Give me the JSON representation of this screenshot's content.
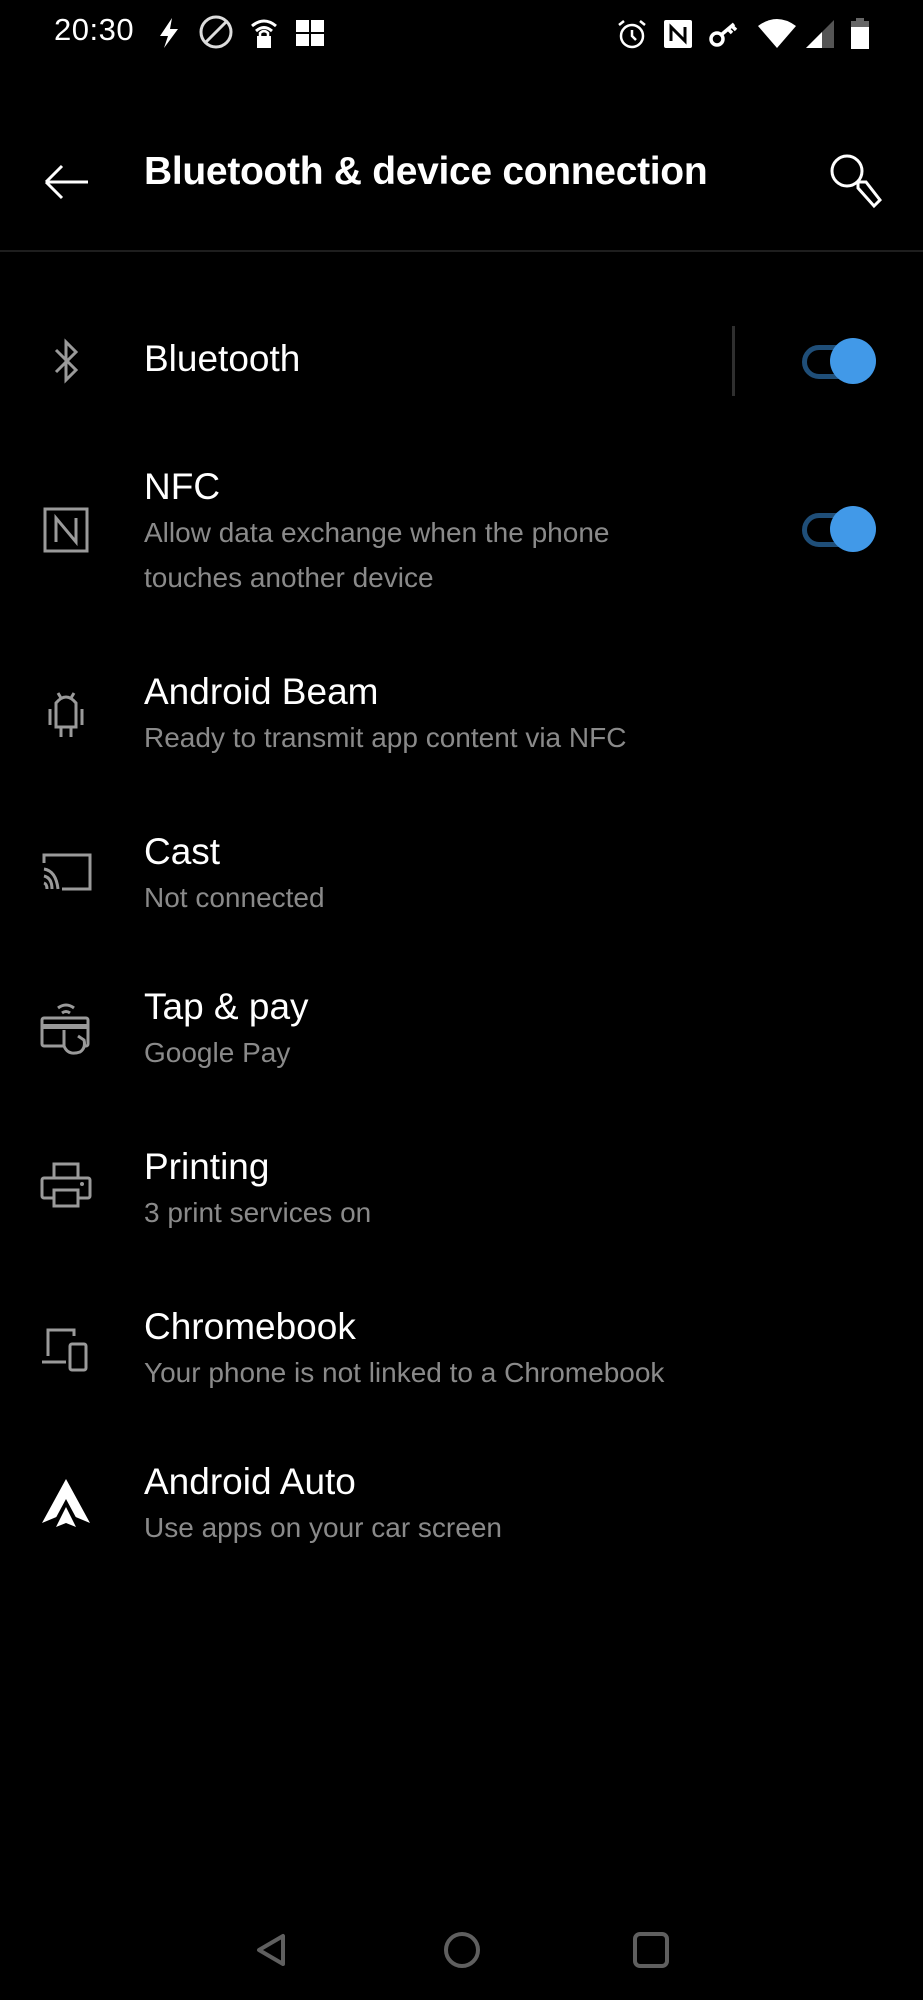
{
  "status_bar": {
    "time": "20:30",
    "left_icons": [
      "flash-icon",
      "no-data-icon",
      "wifi-lock-icon",
      "app-notification-icon"
    ],
    "right_icons": [
      "alarm-icon",
      "nfc-icon",
      "vpn-key-icon",
      "wifi-icon",
      "signal-icon",
      "battery-icon"
    ]
  },
  "app_bar": {
    "title": "Bluetooth & device connection",
    "back_icon": "arrow-back-icon",
    "search_icon": "search-icon"
  },
  "settings": [
    {
      "title": "Bluetooth",
      "subtitle": "",
      "icon": "bluetooth-icon",
      "toggle": true,
      "toggle_on": true
    },
    {
      "title": "NFC",
      "subtitle_lines": [
        "Allow data exchange when the phone",
        "touches another device"
      ],
      "icon": "nfc-icon",
      "toggle": true,
      "toggle_on": true
    },
    {
      "title": "Android Beam",
      "subtitle": "Ready to transmit app content via NFC",
      "icon": "android-icon"
    },
    {
      "title": "Cast",
      "subtitle": "Not connected",
      "icon": "cast-icon"
    },
    {
      "title": "Tap & pay",
      "subtitle": "Google Pay",
      "icon": "tap-pay-icon"
    },
    {
      "title": "Printing",
      "subtitle": "3 print services on",
      "icon": "printer-icon"
    },
    {
      "title": "Chromebook",
      "subtitle": "Your phone is not linked to a Chromebook",
      "icon": "devices-icon"
    },
    {
      "title": "Android Auto",
      "subtitle": "Use apps on your car screen",
      "icon": "android-auto-icon"
    }
  ],
  "nav_bar": {
    "back": "nav-back-icon",
    "home": "nav-home-icon",
    "recents": "nav-recents-icon"
  },
  "colors": {
    "accent": "#4199e8",
    "track": "#1f4e78",
    "subtitle": "#8a8a8a",
    "icon": "#9a9a9a",
    "background": "#000000"
  }
}
